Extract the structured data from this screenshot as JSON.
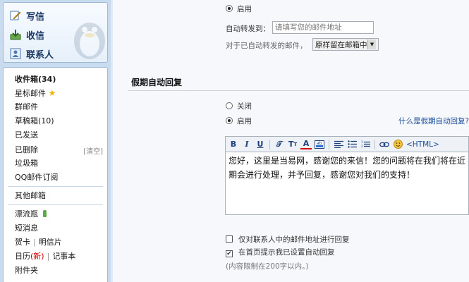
{
  "sidebar": {
    "actions": {
      "compose": "写信",
      "receive": "收信",
      "contacts": "联系人"
    },
    "folders": {
      "inbox": "收件箱(34)",
      "starred": "星标邮件",
      "group": "群邮件",
      "drafts": "草稿箱(10)",
      "sent": "已发送",
      "deleted": "已删除",
      "deleted_clear": "[清空]",
      "spam": "垃圾箱",
      "qq_subscription": "QQ邮件订阅"
    },
    "other_folders": "其他邮箱",
    "tools": {
      "bottle": "漂流瓶",
      "sms": "短消息",
      "card": "贺卡",
      "postcard": "明信片",
      "calendar": "日历",
      "calendar_new": "(新)",
      "notepad": "记事本",
      "attachments": "附件夹"
    }
  },
  "forwarding": {
    "enable_label": "启用",
    "forward_to_label": "自动转发到：",
    "forward_to_placeholder": "请填写您的邮件地址",
    "forwarded_handling_label": "对于已自动转发的邮件，",
    "forwarded_handling_value": "原样留在邮箱中"
  },
  "auto_reply": {
    "section_title": "假期自动回复",
    "off_label": "关闭",
    "on_label": "启用",
    "help_link": "什么是假期自动回复?",
    "html_toggle": "<HTML>",
    "message": "您好，这里是当易网，感谢您的来信！您的问题将在我们将在近期会进行处理，并予回复，感谢您对我们的支持！",
    "contacts_only_label": "仅对联系人中的邮件地址进行回复",
    "homepage_notice_label": "在首页提示我已设置自动回复",
    "limit_note": "(内容限制在200字以内。)"
  },
  "state": {
    "forwarding_enabled": true,
    "auto_reply_enabled": true,
    "contacts_only_checked": false,
    "homepage_notice_checked": true
  },
  "colors": {
    "sidebar_bg": "#c9dcef",
    "link": "#1c4f9c",
    "new_badge": "#d40000"
  }
}
